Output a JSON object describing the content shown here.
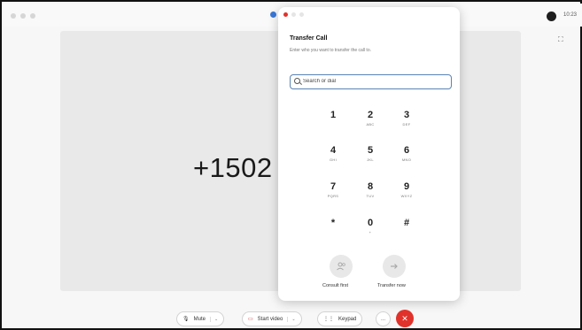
{
  "topbar": {
    "time": "10:23",
    "colors": {
      "app_dot": "#3a78d8",
      "avatar": "#1e1e1e"
    }
  },
  "call": {
    "number": "+1502"
  },
  "transfer_panel": {
    "title": "Transfer Call",
    "subtitle": "Enter who you want to transfer the call to.",
    "search_placeholder": "Search or dial",
    "window_dots_colors": [
      "#e0322b",
      "#e5e5e5",
      "#e5e5e5"
    ],
    "keypad": [
      {
        "digit": "1",
        "letters": ""
      },
      {
        "digit": "2",
        "letters": "ABC"
      },
      {
        "digit": "3",
        "letters": "DEF"
      },
      {
        "digit": "4",
        "letters": "GHI"
      },
      {
        "digit": "5",
        "letters": "JKL"
      },
      {
        "digit": "6",
        "letters": "MNO"
      },
      {
        "digit": "7",
        "letters": "PQRS"
      },
      {
        "digit": "8",
        "letters": "TUV"
      },
      {
        "digit": "9",
        "letters": "WXYZ"
      },
      {
        "digit": "*",
        "letters": ""
      },
      {
        "digit": "0",
        "letters": "+"
      },
      {
        "digit": "#",
        "letters": ""
      }
    ],
    "consult_label": "Consult first",
    "transfer_label": "Transfer now",
    "consult_icon": "consult-person-icon",
    "transfer_icon": "arrow-right-icon"
  },
  "toolbar": {
    "mute_label": "Mute",
    "video_label": "Start video",
    "keypad_label": "Keypad",
    "more_label": "...",
    "end_call_color": "#e0322b"
  }
}
